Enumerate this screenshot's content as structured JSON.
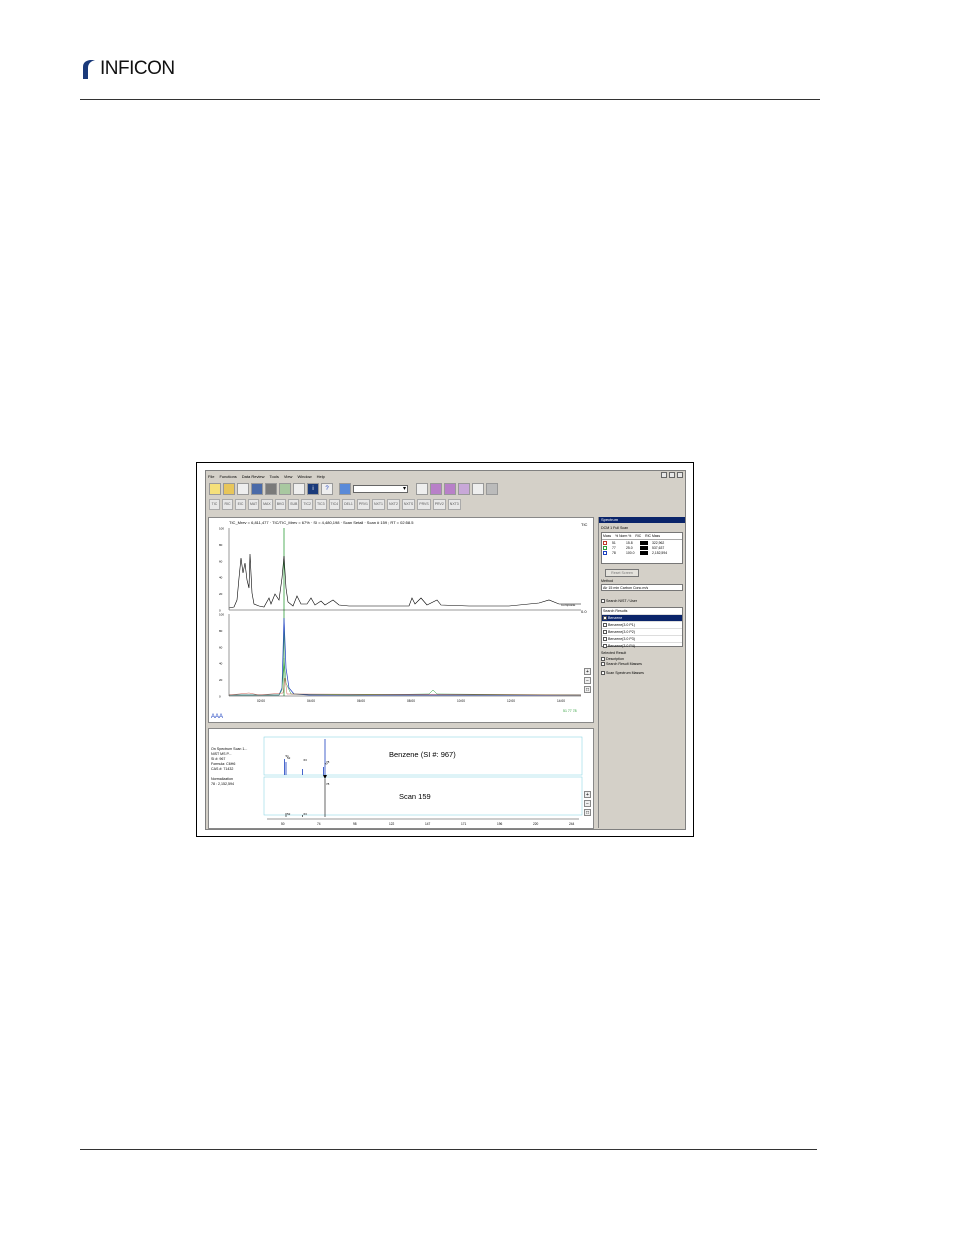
{
  "header": {
    "logo_text": "INFICON"
  },
  "window": {
    "menu": [
      "File",
      "Functions",
      "Data Review",
      "Tools",
      "View",
      "Window",
      "Help"
    ],
    "toolbar2_labels": [
      "TIC",
      "RIC",
      "EIC",
      "MAT",
      "MAX",
      "BKG",
      "SUB",
      "TIC2",
      "TIC3",
      "TIC4",
      "DEL1",
      "PRV1",
      "NXT1",
      "NXT2",
      "NXTS",
      "PRVS",
      "PRV2",
      "NXT3"
    ],
    "chromatogram": {
      "header_text": "TIC_Mrev = 6,811,477 · TIC/TIC_Mrev = 67% · SI = 4,480,198 · Scan Setall · Scan # 159 ; RT = 02:58.5",
      "right_top": "TIC",
      "right_mid": "0.0",
      "trace_label": "Composite",
      "x_ticks": [
        "02:00",
        "04:00",
        "06:00",
        "08:00",
        "10:00",
        "12:00",
        "14:00"
      ],
      "y_ticks": [
        "100",
        "80",
        "60",
        "40",
        "20",
        "0"
      ],
      "legend": "51  77  78"
    },
    "spectrum": {
      "info": [
        "On Spectrum Scan 1...",
        "NIST MS P...",
        "SI #: 967",
        "Formula: C6H6",
        "CAS #: 71432",
        "",
        "Normalization",
        "78 : 2,152,594"
      ],
      "library_title": "Benzene (SI #: 967)",
      "scan_title": "Scan 159",
      "x_ticks": [
        "50",
        "74",
        "98",
        "122",
        "147",
        "171",
        "196",
        "220",
        "244"
      ],
      "peaks_top": [
        {
          "m": "51",
          "lbl": "51"
        },
        {
          "m": "52",
          "lbl": "52"
        },
        {
          "m": "63",
          "lbl": "63"
        },
        {
          "m": "78",
          "lbl": "78"
        },
        {
          "m": "77",
          "lbl": "77"
        }
      ],
      "peaks_bottom": [
        {
          "lbl": "52"
        },
        {
          "lbl": "63"
        },
        {
          "lbl": "78"
        }
      ]
    },
    "panel": {
      "title": "Spectrum",
      "mode": "DCM 1 Full Scan",
      "cols": [
        "Mass",
        "% Norm %",
        "RIC",
        "RIC Mass"
      ],
      "rows": [
        {
          "mass": "51",
          "norm": "15.8",
          "ric": "322,962"
        },
        {
          "mass": "77",
          "norm": "25.0",
          "ric": "537,637"
        },
        {
          "mass": "78",
          "norm": "100.0",
          "ric": "2,152,594"
        }
      ],
      "button": "Reset Screen",
      "method_label": "Method",
      "method_value": "Air 15 min Carbon Conc.m/s",
      "search_nist": "Search NIST / User",
      "search_results": "Search Results",
      "results": [
        "Benzene",
        "Benzene(3.0 P1)",
        "Benzene(3.0 P2)",
        "Benzene(3.0 P3)",
        "Benzene(3.0 P4)"
      ],
      "selected_result": "Selected Result",
      "description": "Description",
      "search_result_masses": "Search Result Masses",
      "scan_spectrum_masses": "Scan Spectrum Masses"
    }
  },
  "colors": {
    "tic": "#000000",
    "trace51": "#c0392b",
    "trace77": "#2e9e3a",
    "trace78": "#1a3fbf",
    "highlight": "#0a246a"
  }
}
